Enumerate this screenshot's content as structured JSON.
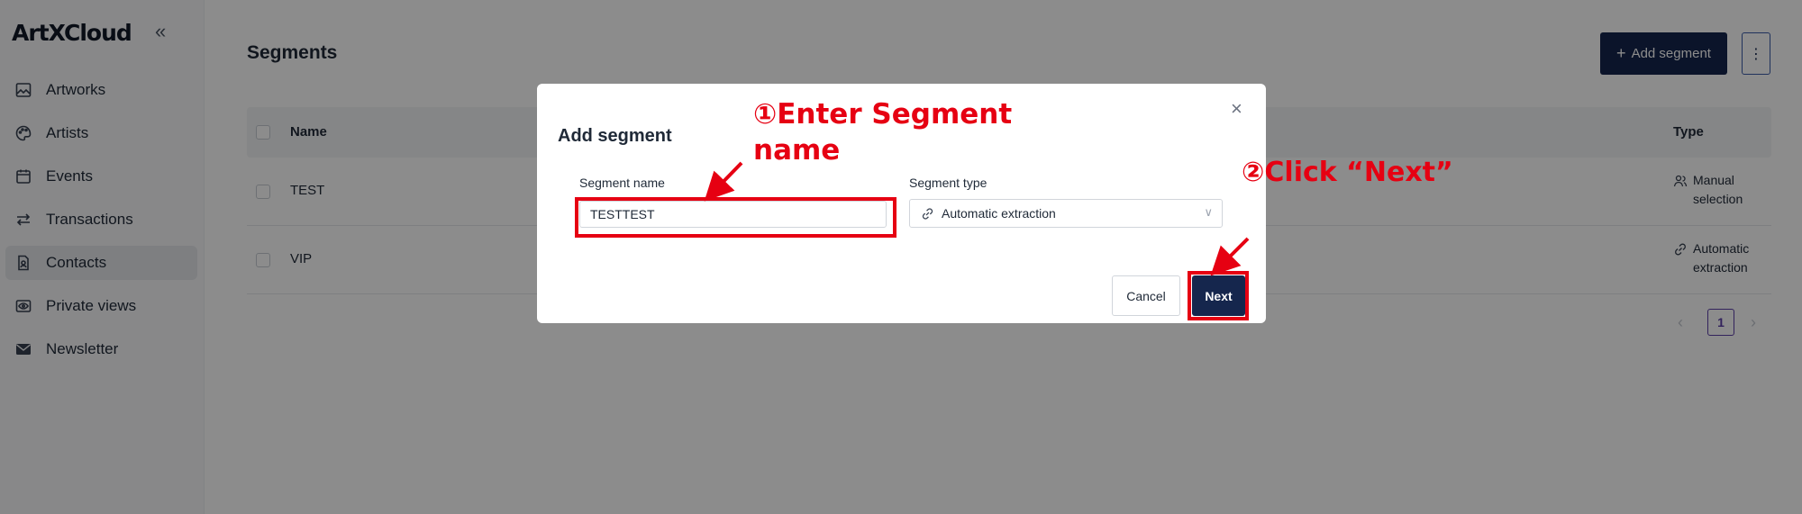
{
  "app": {
    "logo": "ArtXCloud"
  },
  "sidebar": {
    "collapse_glyph": "«",
    "items": [
      {
        "label": "Artworks",
        "icon": "image-icon"
      },
      {
        "label": "Artists",
        "icon": "palette-icon"
      },
      {
        "label": "Events",
        "icon": "calendar-icon"
      },
      {
        "label": "Transactions",
        "icon": "swap-arrows-icon"
      },
      {
        "label": "Contacts",
        "icon": "contact-card-icon",
        "active": true
      },
      {
        "label": "Private views",
        "icon": "eye-icon"
      },
      {
        "label": "Newsletter",
        "icon": "mail-icon"
      }
    ]
  },
  "main": {
    "title": "Segments",
    "add_button": "Add segment",
    "add_button_glyph": "+",
    "more_glyph": "⋮",
    "table": {
      "headers": {
        "name": "Name",
        "type": "Type"
      },
      "rows": [
        {
          "name": "TEST",
          "type_line1": "Manual",
          "type_line2": "selection",
          "type_icon": "users-icon"
        },
        {
          "name": "VIP",
          "type_line1": "Automatic",
          "type_line2": "extraction",
          "type_icon": "link-icon"
        }
      ]
    },
    "pagination": {
      "prev": "‹",
      "current": "1",
      "next": "›"
    }
  },
  "modal": {
    "title": "Add segment",
    "close_glyph": "×",
    "segment_name_label": "Segment name",
    "segment_name_value": "TESTTEST",
    "segment_type_label": "Segment type",
    "segment_type_value": "Automatic extraction",
    "chevron_glyph": "∨",
    "cancel": "Cancel",
    "next": "Next"
  },
  "annotations": {
    "step1_line1": "①Enter Segment",
    "step1_line2": "name",
    "step2": "②Click “Next”",
    "color": "#e60012"
  },
  "colors": {
    "primary": "#15264d",
    "pager_accent": "#5b3fa8"
  }
}
